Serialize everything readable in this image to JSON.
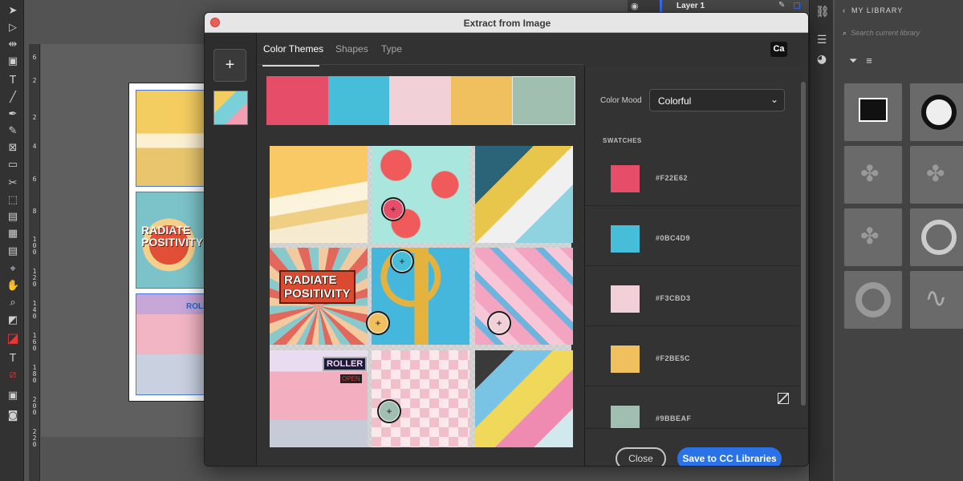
{
  "dialog": {
    "title": "Extract from Image",
    "tabs": [
      "Color Themes",
      "Shapes",
      "Type"
    ],
    "add_label": "+",
    "app_badge": "Ca",
    "color_mood_label": "Color Mood",
    "color_mood_value": "Colorful",
    "swatches_header": "SWATCHES",
    "swatches": [
      {
        "hex": "#F22E62",
        "color": "#e64d69"
      },
      {
        "hex": "#0BC4D9",
        "color": "#46bed9"
      },
      {
        "hex": "#F3CBD3",
        "color": "#f2d0d8"
      },
      {
        "hex": "#F2BE5C",
        "color": "#f0c05f"
      },
      {
        "hex": "#9BBEAF",
        "color": "#a0bfb1"
      }
    ],
    "palette_colors": [
      "#e64d69",
      "#46bed9",
      "#f2d0d8",
      "#f0c05f",
      "#a0bfb1"
    ],
    "mosaic_texts": {
      "radiate": "RADIATE",
      "positivity": "POSITIVITY",
      "roller": "ROLLER",
      "open": "OPEN"
    },
    "buttons": {
      "close": "Close",
      "save": "Save to CC Libraries"
    }
  },
  "layers": {
    "label": "Layer 1"
  },
  "library": {
    "title": "MY LIBRARY",
    "search_placeholder": "Search current library"
  },
  "ruler": {
    "labels": [
      "6",
      "2",
      "2",
      "4",
      "6",
      "8",
      "1 0 0",
      "1 2 0",
      "1 4 0",
      "1 6 0",
      "1 8 0",
      "2 0 0",
      "2 2 0"
    ]
  },
  "document": {
    "frame_texts": {
      "radiate": "RADIATE",
      "positivity": "POSITIVITY",
      "roller": "ROLLER"
    }
  }
}
